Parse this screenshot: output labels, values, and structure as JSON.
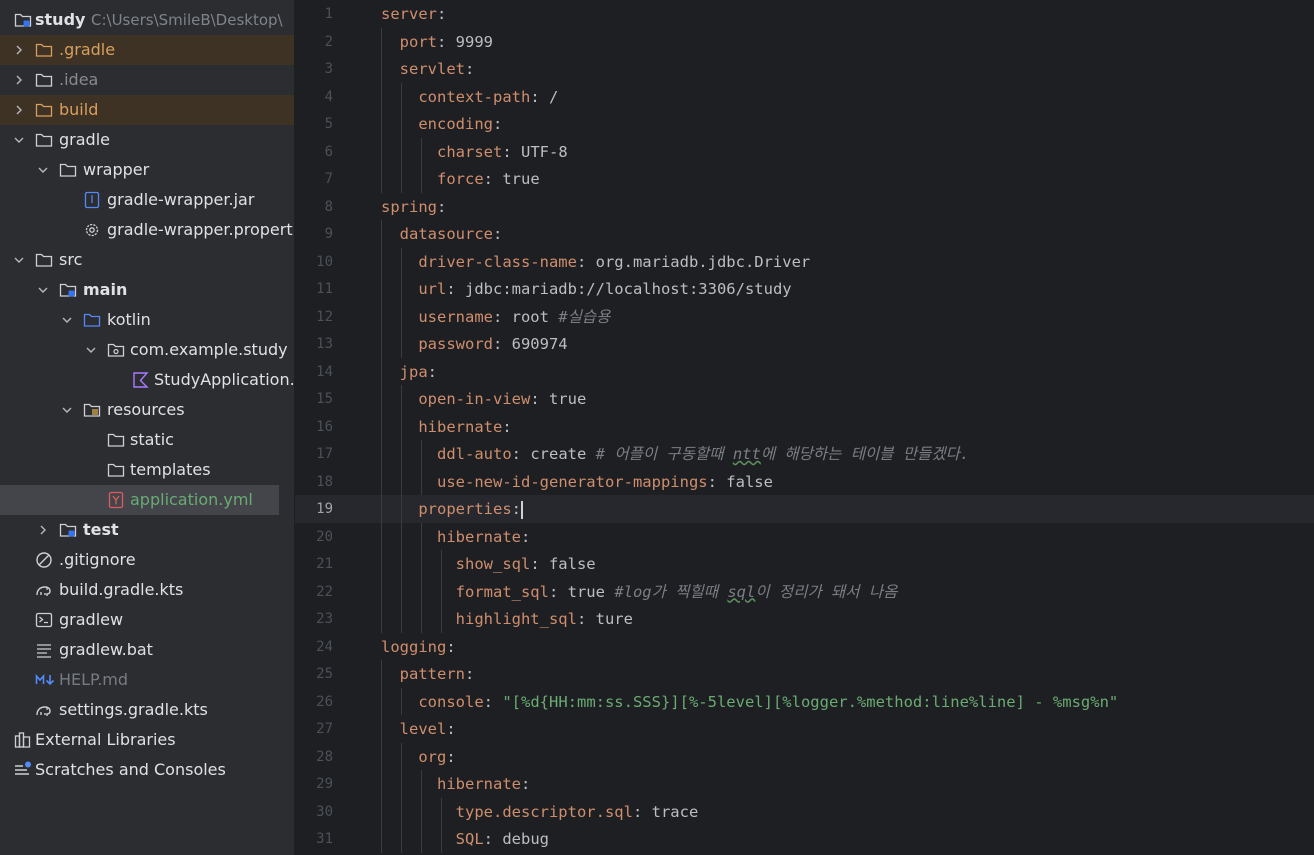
{
  "project_tree": {
    "root_name": "study",
    "root_path": "C:\\Users\\SmileB\\Desktop\\",
    "items": [
      {
        "label": "study",
        "icon": "module-folder-icon"
      },
      {
        "label": ".gradle",
        "icon": "folder-icon"
      },
      {
        "label": ".idea",
        "icon": "folder-icon"
      },
      {
        "label": "build",
        "icon": "folder-icon"
      },
      {
        "label": "gradle",
        "icon": "folder-icon"
      },
      {
        "label": "wrapper",
        "icon": "folder-icon"
      },
      {
        "label": "gradle-wrapper.jar",
        "icon": "jar-file-icon"
      },
      {
        "label": "gradle-wrapper.properties",
        "icon": "settings-file-icon"
      },
      {
        "label": "src",
        "icon": "folder-icon"
      },
      {
        "label": "main",
        "icon": "module-folder-icon"
      },
      {
        "label": "kotlin",
        "icon": "source-folder-icon"
      },
      {
        "label": "com.example.study",
        "icon": "package-icon"
      },
      {
        "label": "StudyApplication.kt",
        "icon": "kotlin-file-icon"
      },
      {
        "label": "resources",
        "icon": "resources-folder-icon"
      },
      {
        "label": "static",
        "icon": "folder-icon"
      },
      {
        "label": "templates",
        "icon": "folder-icon"
      },
      {
        "label": "application.yml",
        "icon": "yaml-file-icon"
      },
      {
        "label": "test",
        "icon": "module-folder-icon"
      },
      {
        "label": ".gitignore",
        "icon": "ignore-file-icon"
      },
      {
        "label": "build.gradle.kts",
        "icon": "gradle-elephant-icon"
      },
      {
        "label": "gradlew",
        "icon": "terminal-file-icon"
      },
      {
        "label": "gradlew.bat",
        "icon": "text-file-icon"
      },
      {
        "label": "HELP.md",
        "icon": "markdown-file-icon"
      },
      {
        "label": "settings.gradle.kts",
        "icon": "gradle-elephant-icon"
      },
      {
        "label": "External Libraries",
        "icon": "libraries-icon"
      },
      {
        "label": "Scratches and Consoles",
        "icon": "scratches-icon"
      }
    ]
  },
  "editor": {
    "current_line": 19,
    "lines": [
      {
        "n": 1,
        "t": [
          [
            "k",
            "server"
          ],
          [
            "p",
            ":"
          ]
        ]
      },
      {
        "n": 2,
        "t": [
          [
            "p",
            "  "
          ],
          [
            "k",
            "port"
          ],
          [
            "p",
            ": 9999"
          ]
        ]
      },
      {
        "n": 3,
        "t": [
          [
            "p",
            "  "
          ],
          [
            "k",
            "servlet"
          ],
          [
            "p",
            ":"
          ]
        ]
      },
      {
        "n": 4,
        "t": [
          [
            "p",
            "    "
          ],
          [
            "k",
            "context-path"
          ],
          [
            "p",
            ": /"
          ]
        ]
      },
      {
        "n": 5,
        "t": [
          [
            "p",
            "    "
          ],
          [
            "k",
            "encoding"
          ],
          [
            "p",
            ":"
          ]
        ]
      },
      {
        "n": 6,
        "t": [
          [
            "p",
            "      "
          ],
          [
            "k",
            "charset"
          ],
          [
            "p",
            ": UTF-8"
          ]
        ]
      },
      {
        "n": 7,
        "t": [
          [
            "p",
            "      "
          ],
          [
            "k",
            "force"
          ],
          [
            "p",
            ": true"
          ]
        ]
      },
      {
        "n": 8,
        "t": [
          [
            "k",
            "spring"
          ],
          [
            "p",
            ":"
          ]
        ]
      },
      {
        "n": 9,
        "t": [
          [
            "p",
            "  "
          ],
          [
            "k",
            "datasource"
          ],
          [
            "p",
            ":"
          ]
        ]
      },
      {
        "n": 10,
        "t": [
          [
            "p",
            "    "
          ],
          [
            "k",
            "driver-class-name"
          ],
          [
            "p",
            ": org.mariadb.jdbc.Driver"
          ]
        ]
      },
      {
        "n": 11,
        "t": [
          [
            "p",
            "    "
          ],
          [
            "k",
            "url"
          ],
          [
            "p",
            ": jdbc:mariadb://localhost:3306/study"
          ]
        ]
      },
      {
        "n": 12,
        "t": [
          [
            "p",
            "    "
          ],
          [
            "k",
            "username"
          ],
          [
            "p",
            ": root "
          ],
          [
            "c",
            "#실습용"
          ]
        ]
      },
      {
        "n": 13,
        "t": [
          [
            "p",
            "    "
          ],
          [
            "k",
            "password"
          ],
          [
            "p",
            ": 690974"
          ]
        ]
      },
      {
        "n": 14,
        "t": [
          [
            "p",
            "  "
          ],
          [
            "k",
            "jpa"
          ],
          [
            "p",
            ":"
          ]
        ]
      },
      {
        "n": 15,
        "t": [
          [
            "p",
            "    "
          ],
          [
            "k",
            "open-in-view"
          ],
          [
            "p",
            ": true"
          ]
        ]
      },
      {
        "n": 16,
        "t": [
          [
            "p",
            "    "
          ],
          [
            "k",
            "hibernate"
          ],
          [
            "p",
            ":"
          ]
        ]
      },
      {
        "n": 17,
        "t": [
          [
            "p",
            "      "
          ],
          [
            "k",
            "ddl-auto"
          ],
          [
            "p",
            ": create "
          ],
          [
            "c",
            "# 어플이 구동할때 "
          ],
          [
            "cw",
            "ntt"
          ],
          [
            "c",
            "에 해당하는 테이블 만들겠다."
          ]
        ]
      },
      {
        "n": 18,
        "t": [
          [
            "p",
            "      "
          ],
          [
            "k",
            "use-new-id-generator-mappings"
          ],
          [
            "p",
            ": false"
          ]
        ]
      },
      {
        "n": 19,
        "t": [
          [
            "p",
            "    "
          ],
          [
            "k",
            "properties"
          ],
          [
            "p",
            ":"
          ],
          [
            "caret",
            ""
          ]
        ]
      },
      {
        "n": 20,
        "t": [
          [
            "p",
            "      "
          ],
          [
            "k",
            "hibernate"
          ],
          [
            "p",
            ":"
          ]
        ]
      },
      {
        "n": 21,
        "t": [
          [
            "p",
            "        "
          ],
          [
            "k",
            "show_sql"
          ],
          [
            "p",
            ": false"
          ]
        ]
      },
      {
        "n": 22,
        "t": [
          [
            "p",
            "        "
          ],
          [
            "k",
            "format_sql"
          ],
          [
            "p",
            ": true "
          ],
          [
            "c",
            "#log가 찍힐때 "
          ],
          [
            "cw",
            "sql"
          ],
          [
            "c",
            "이 정리가 돼서 나옴"
          ]
        ]
      },
      {
        "n": 23,
        "t": [
          [
            "p",
            "        "
          ],
          [
            "k",
            "highlight_sql"
          ],
          [
            "p",
            ": ture"
          ]
        ]
      },
      {
        "n": 24,
        "t": [
          [
            "k",
            "logging"
          ],
          [
            "p",
            ":"
          ]
        ]
      },
      {
        "n": 25,
        "t": [
          [
            "p",
            "  "
          ],
          [
            "k",
            "pattern"
          ],
          [
            "p",
            ":"
          ]
        ]
      },
      {
        "n": 26,
        "t": [
          [
            "p",
            "    "
          ],
          [
            "k",
            "console"
          ],
          [
            "p",
            ": "
          ],
          [
            "s",
            "\"[%d{HH:mm:ss.SSS}][%-5level][%logger.%method:line%line] - %msg%n\""
          ]
        ]
      },
      {
        "n": 27,
        "t": [
          [
            "p",
            "  "
          ],
          [
            "k",
            "level"
          ],
          [
            "p",
            ":"
          ]
        ]
      },
      {
        "n": 28,
        "t": [
          [
            "p",
            "    "
          ],
          [
            "k",
            "org"
          ],
          [
            "p",
            ":"
          ]
        ]
      },
      {
        "n": 29,
        "t": [
          [
            "p",
            "      "
          ],
          [
            "k",
            "hibernate"
          ],
          [
            "p",
            ":"
          ]
        ]
      },
      {
        "n": 30,
        "t": [
          [
            "p",
            "        "
          ],
          [
            "k",
            "type.descriptor.sql"
          ],
          [
            "p",
            ": trace"
          ]
        ]
      },
      {
        "n": 31,
        "t": [
          [
            "p",
            "        "
          ],
          [
            "k",
            "SQL"
          ],
          [
            "p",
            ": debug"
          ]
        ]
      }
    ]
  },
  "colors": {
    "sidebar_bg": "#2b2d30",
    "editor_bg": "#1e1f22",
    "yaml_key": "#cf8e6d",
    "string": "#6aab73",
    "comment": "#7a7e85",
    "excluded_folder": "#d99f5e"
  }
}
